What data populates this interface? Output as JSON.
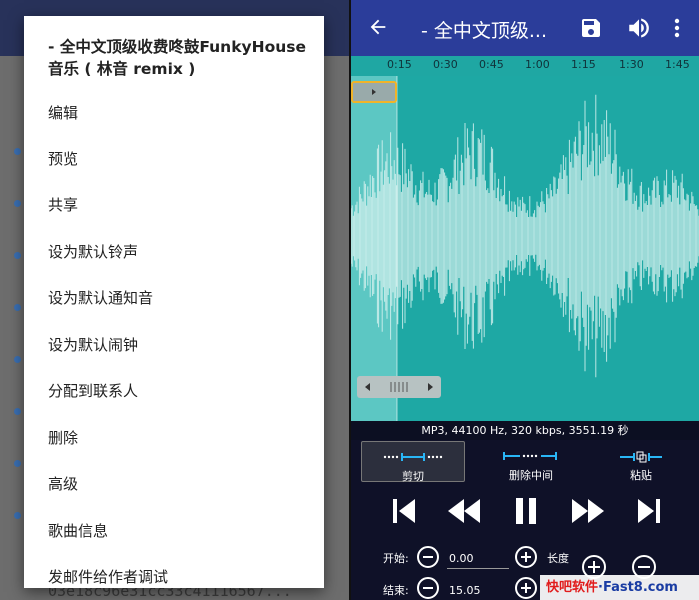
{
  "menu": {
    "title": "- 全中文顶级收费咚鼓FunkyHouse音乐 ( 林音 remix )",
    "items": [
      "编辑",
      "预览",
      "共享",
      "设为默认铃声",
      "设为默认通知音",
      "设为默认闹钟",
      "分配到联系人",
      "删除",
      "高级",
      "歌曲信息",
      "发邮件给作者调试"
    ]
  },
  "background_list": {
    "last_row_text": "03e18c96e31cc33c41116567..."
  },
  "editor": {
    "title": "- 全中文顶级...",
    "ruler_ticks": [
      "0:15",
      "0:30",
      "0:45",
      "1:00",
      "1:15",
      "1:30",
      "1:45"
    ],
    "info": "MP3, 44100 Hz, 320 kbps, 3551.19 秒",
    "modes": [
      "剪切",
      "删除中间",
      "粘贴"
    ],
    "selected_mode": "剪切",
    "start_label": "开始:",
    "start_value": "0.00",
    "length_label": "长度",
    "end_label": "结束:",
    "end_value": "15.05",
    "icons": [
      "back-arrow-icon",
      "save-icon",
      "volume-icon",
      "more-vert-icon",
      "skip-start-icon",
      "rewind-icon",
      "pause-icon",
      "fast-forward-icon",
      "skip-end-icon",
      "zoom-in-icon",
      "zoom-out-icon"
    ]
  },
  "watermark": {
    "part1": "快吧软件",
    "part2": "·Fast8.com"
  },
  "colors": {
    "toolbar": "#2b3d9a",
    "waveform_bg": "#1ea8a4",
    "waveform": "#d7f2f0",
    "selection": "#8fe0dc",
    "handle": "#f0b429"
  }
}
